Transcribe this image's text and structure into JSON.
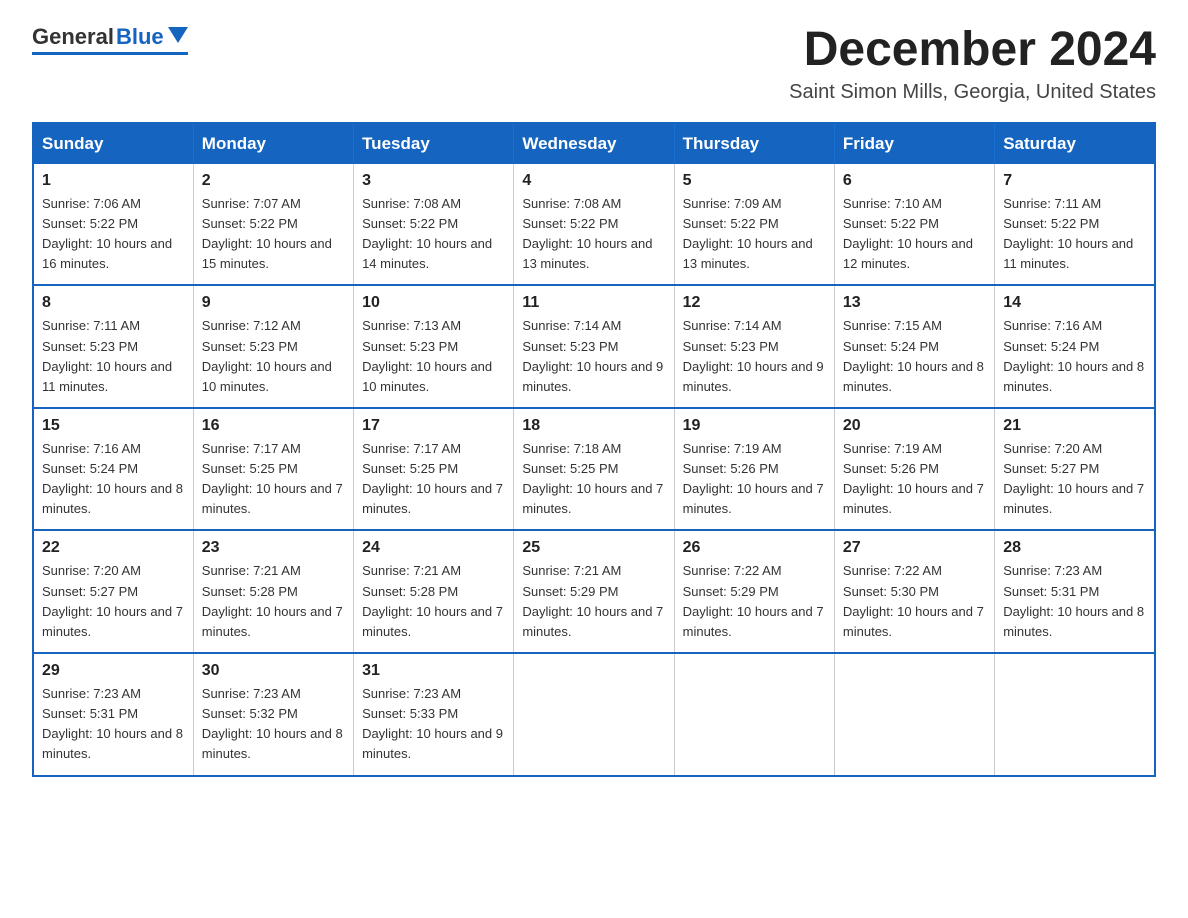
{
  "header": {
    "logo_general": "General",
    "logo_blue": "Blue",
    "month_title": "December 2024",
    "location": "Saint Simon Mills, Georgia, United States"
  },
  "weekdays": [
    "Sunday",
    "Monday",
    "Tuesday",
    "Wednesday",
    "Thursday",
    "Friday",
    "Saturday"
  ],
  "weeks": [
    [
      {
        "day": "1",
        "sunrise": "Sunrise: 7:06 AM",
        "sunset": "Sunset: 5:22 PM",
        "daylight": "Daylight: 10 hours and 16 minutes."
      },
      {
        "day": "2",
        "sunrise": "Sunrise: 7:07 AM",
        "sunset": "Sunset: 5:22 PM",
        "daylight": "Daylight: 10 hours and 15 minutes."
      },
      {
        "day": "3",
        "sunrise": "Sunrise: 7:08 AM",
        "sunset": "Sunset: 5:22 PM",
        "daylight": "Daylight: 10 hours and 14 minutes."
      },
      {
        "day": "4",
        "sunrise": "Sunrise: 7:08 AM",
        "sunset": "Sunset: 5:22 PM",
        "daylight": "Daylight: 10 hours and 13 minutes."
      },
      {
        "day": "5",
        "sunrise": "Sunrise: 7:09 AM",
        "sunset": "Sunset: 5:22 PM",
        "daylight": "Daylight: 10 hours and 13 minutes."
      },
      {
        "day": "6",
        "sunrise": "Sunrise: 7:10 AM",
        "sunset": "Sunset: 5:22 PM",
        "daylight": "Daylight: 10 hours and 12 minutes."
      },
      {
        "day": "7",
        "sunrise": "Sunrise: 7:11 AM",
        "sunset": "Sunset: 5:22 PM",
        "daylight": "Daylight: 10 hours and 11 minutes."
      }
    ],
    [
      {
        "day": "8",
        "sunrise": "Sunrise: 7:11 AM",
        "sunset": "Sunset: 5:23 PM",
        "daylight": "Daylight: 10 hours and 11 minutes."
      },
      {
        "day": "9",
        "sunrise": "Sunrise: 7:12 AM",
        "sunset": "Sunset: 5:23 PM",
        "daylight": "Daylight: 10 hours and 10 minutes."
      },
      {
        "day": "10",
        "sunrise": "Sunrise: 7:13 AM",
        "sunset": "Sunset: 5:23 PM",
        "daylight": "Daylight: 10 hours and 10 minutes."
      },
      {
        "day": "11",
        "sunrise": "Sunrise: 7:14 AM",
        "sunset": "Sunset: 5:23 PM",
        "daylight": "Daylight: 10 hours and 9 minutes."
      },
      {
        "day": "12",
        "sunrise": "Sunrise: 7:14 AM",
        "sunset": "Sunset: 5:23 PM",
        "daylight": "Daylight: 10 hours and 9 minutes."
      },
      {
        "day": "13",
        "sunrise": "Sunrise: 7:15 AM",
        "sunset": "Sunset: 5:24 PM",
        "daylight": "Daylight: 10 hours and 8 minutes."
      },
      {
        "day": "14",
        "sunrise": "Sunrise: 7:16 AM",
        "sunset": "Sunset: 5:24 PM",
        "daylight": "Daylight: 10 hours and 8 minutes."
      }
    ],
    [
      {
        "day": "15",
        "sunrise": "Sunrise: 7:16 AM",
        "sunset": "Sunset: 5:24 PM",
        "daylight": "Daylight: 10 hours and 8 minutes."
      },
      {
        "day": "16",
        "sunrise": "Sunrise: 7:17 AM",
        "sunset": "Sunset: 5:25 PM",
        "daylight": "Daylight: 10 hours and 7 minutes."
      },
      {
        "day": "17",
        "sunrise": "Sunrise: 7:17 AM",
        "sunset": "Sunset: 5:25 PM",
        "daylight": "Daylight: 10 hours and 7 minutes."
      },
      {
        "day": "18",
        "sunrise": "Sunrise: 7:18 AM",
        "sunset": "Sunset: 5:25 PM",
        "daylight": "Daylight: 10 hours and 7 minutes."
      },
      {
        "day": "19",
        "sunrise": "Sunrise: 7:19 AM",
        "sunset": "Sunset: 5:26 PM",
        "daylight": "Daylight: 10 hours and 7 minutes."
      },
      {
        "day": "20",
        "sunrise": "Sunrise: 7:19 AM",
        "sunset": "Sunset: 5:26 PM",
        "daylight": "Daylight: 10 hours and 7 minutes."
      },
      {
        "day": "21",
        "sunrise": "Sunrise: 7:20 AM",
        "sunset": "Sunset: 5:27 PM",
        "daylight": "Daylight: 10 hours and 7 minutes."
      }
    ],
    [
      {
        "day": "22",
        "sunrise": "Sunrise: 7:20 AM",
        "sunset": "Sunset: 5:27 PM",
        "daylight": "Daylight: 10 hours and 7 minutes."
      },
      {
        "day": "23",
        "sunrise": "Sunrise: 7:21 AM",
        "sunset": "Sunset: 5:28 PM",
        "daylight": "Daylight: 10 hours and 7 minutes."
      },
      {
        "day": "24",
        "sunrise": "Sunrise: 7:21 AM",
        "sunset": "Sunset: 5:28 PM",
        "daylight": "Daylight: 10 hours and 7 minutes."
      },
      {
        "day": "25",
        "sunrise": "Sunrise: 7:21 AM",
        "sunset": "Sunset: 5:29 PM",
        "daylight": "Daylight: 10 hours and 7 minutes."
      },
      {
        "day": "26",
        "sunrise": "Sunrise: 7:22 AM",
        "sunset": "Sunset: 5:29 PM",
        "daylight": "Daylight: 10 hours and 7 minutes."
      },
      {
        "day": "27",
        "sunrise": "Sunrise: 7:22 AM",
        "sunset": "Sunset: 5:30 PM",
        "daylight": "Daylight: 10 hours and 7 minutes."
      },
      {
        "day": "28",
        "sunrise": "Sunrise: 7:23 AM",
        "sunset": "Sunset: 5:31 PM",
        "daylight": "Daylight: 10 hours and 8 minutes."
      }
    ],
    [
      {
        "day": "29",
        "sunrise": "Sunrise: 7:23 AM",
        "sunset": "Sunset: 5:31 PM",
        "daylight": "Daylight: 10 hours and 8 minutes."
      },
      {
        "day": "30",
        "sunrise": "Sunrise: 7:23 AM",
        "sunset": "Sunset: 5:32 PM",
        "daylight": "Daylight: 10 hours and 8 minutes."
      },
      {
        "day": "31",
        "sunrise": "Sunrise: 7:23 AM",
        "sunset": "Sunset: 5:33 PM",
        "daylight": "Daylight: 10 hours and 9 minutes."
      },
      null,
      null,
      null,
      null
    ]
  ]
}
